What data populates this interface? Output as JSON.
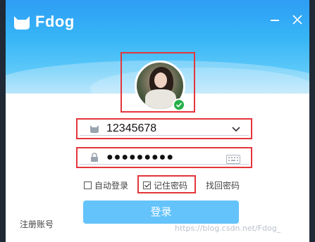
{
  "app": {
    "title": "Fdog",
    "minimize_icon": "minimize-icon",
    "close_icon": "close-icon"
  },
  "avatar": {
    "status": "online",
    "status_icon": "check-icon"
  },
  "form": {
    "username": "12345678",
    "username_icon": "user-icon",
    "username_dropdown_icon": "chevron-down-icon",
    "password_masked": "●●●●●●●●●",
    "password_icon": "lock-icon",
    "keyboard_icon": "keyboard-icon",
    "auto_login_label": "自动登录",
    "auto_login_checked": false,
    "remember_password_label": "记住密码",
    "remember_password_checked": true,
    "recover_password_label": "找回密码",
    "login_button_label": "登录",
    "register_label": "注册账号"
  },
  "watermark": "https://blog.csdn.net/Fdog_",
  "colors": {
    "accent": "#36b5f6",
    "login_button": "#64c3fb",
    "highlight_border": "#e3363b",
    "status_online": "#26b04a"
  }
}
